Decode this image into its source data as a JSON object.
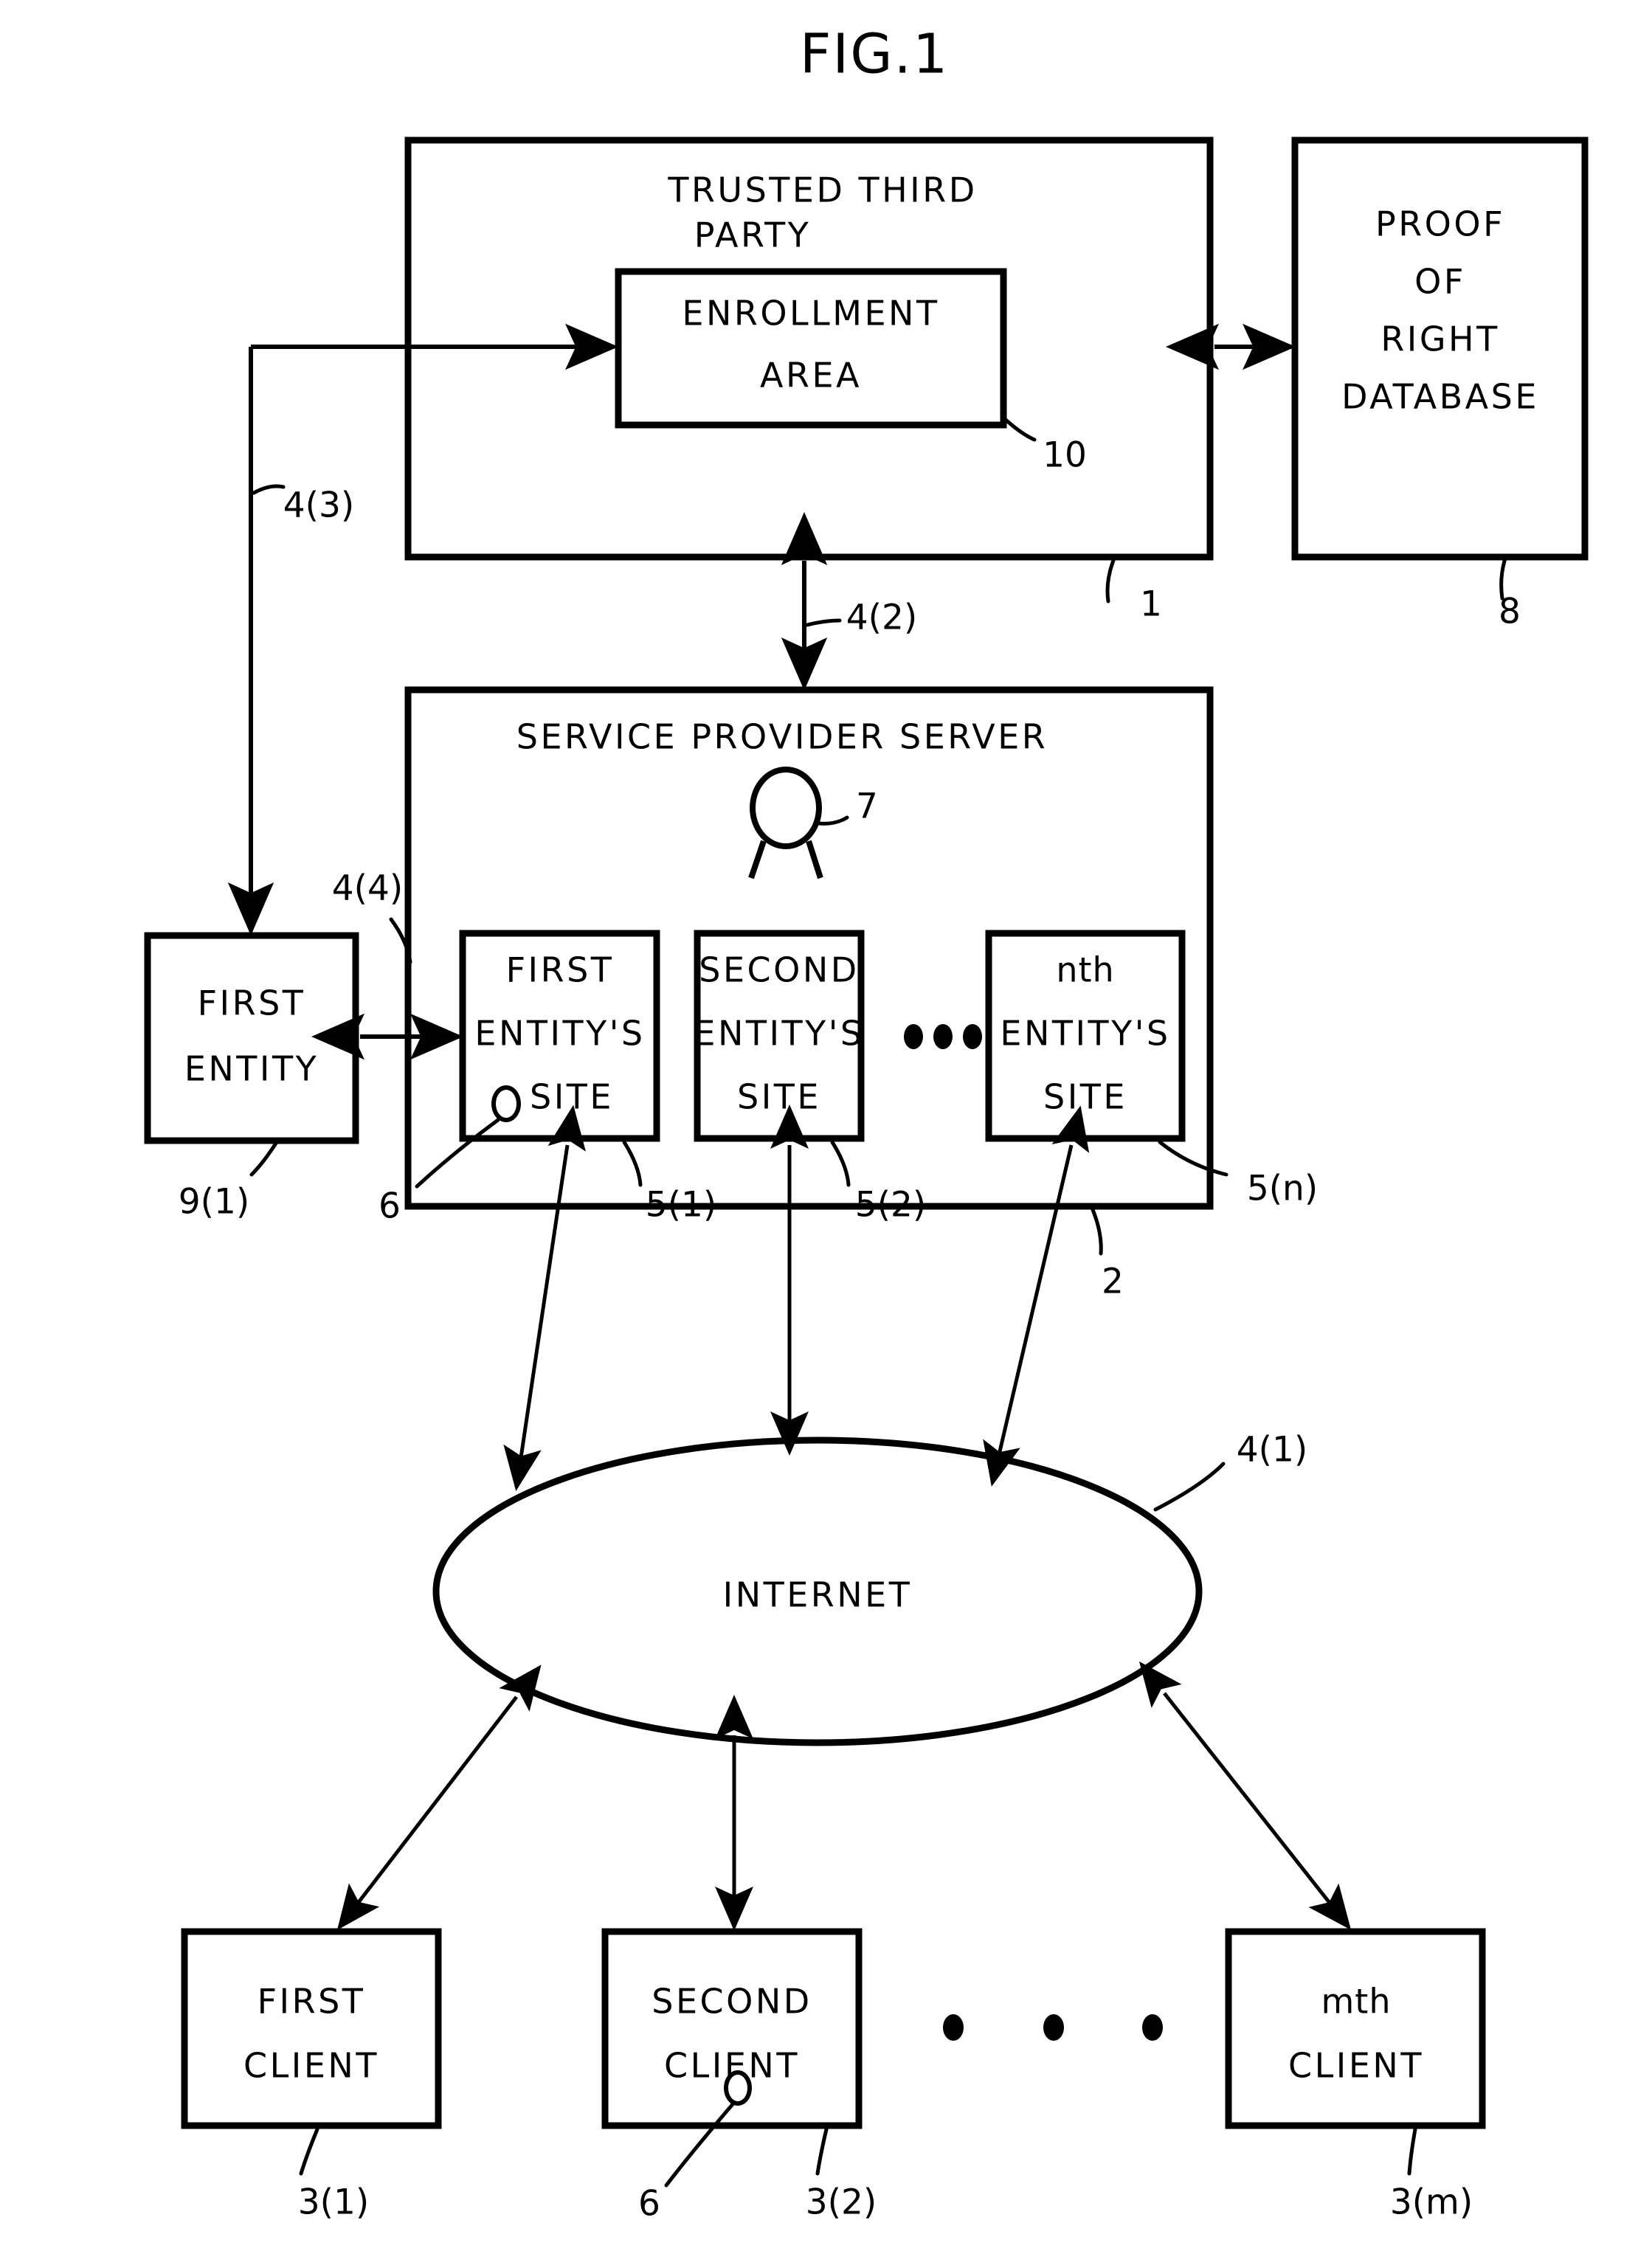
{
  "figure": {
    "title": "FIG.1",
    "background_color": "#ffffff",
    "line_color": "#000000"
  },
  "nodes": {
    "trusted_third_party": {
      "label_line1": "TRUSTED THIRD",
      "label_line2": "PARTY",
      "ref": "1"
    },
    "enrollment_area": {
      "label_line1": "ENROLLMENT",
      "label_line2": "AREA",
      "ref": "10"
    },
    "proof_database": {
      "label_line1": "PROOF",
      "label_line2": "OF",
      "label_line3": "RIGHT",
      "label_line4": "DATABASE",
      "ref": "8"
    },
    "service_provider_server": {
      "label": "SERVICE PROVIDER SERVER",
      "ref": "2",
      "seal_ref": "7"
    },
    "first_entity": {
      "label_line1": "FIRST",
      "label_line2": "ENTITY",
      "ref": "9(1)"
    },
    "first_entity_site": {
      "label_line1": "FIRST",
      "label_line2": "ENTITY'S",
      "label_line3": "SITE",
      "ref": "5(1)",
      "hole_ref": "6"
    },
    "second_entity_site": {
      "label_line1": "SECOND",
      "label_line2": "ENTITY'S",
      "label_line3": "SITE",
      "ref": "5(2)"
    },
    "nth_entity_site": {
      "label_line1": "nth",
      "label_line2": "ENTITY'S",
      "label_line3": "SITE",
      "ref": "5(n)"
    },
    "internet": {
      "label": "INTERNET",
      "ref": "4(1)"
    },
    "first_client": {
      "label_line1": "FIRST",
      "label_line2": "CLIENT",
      "ref": "3(1)"
    },
    "second_client": {
      "label_line1": "SECOND",
      "label_line2": "CLIENT",
      "ref": "3(2)",
      "hole_ref": "6"
    },
    "mth_client": {
      "label_line1": "mth",
      "label_line2": "CLIENT",
      "ref": "3(m)"
    }
  },
  "links": {
    "ttp_to_sps": "4(2)",
    "ttp_to_first_entity": "4(3)",
    "first_entity_to_site": "4(4)",
    "internet_network": "4(1)"
  }
}
